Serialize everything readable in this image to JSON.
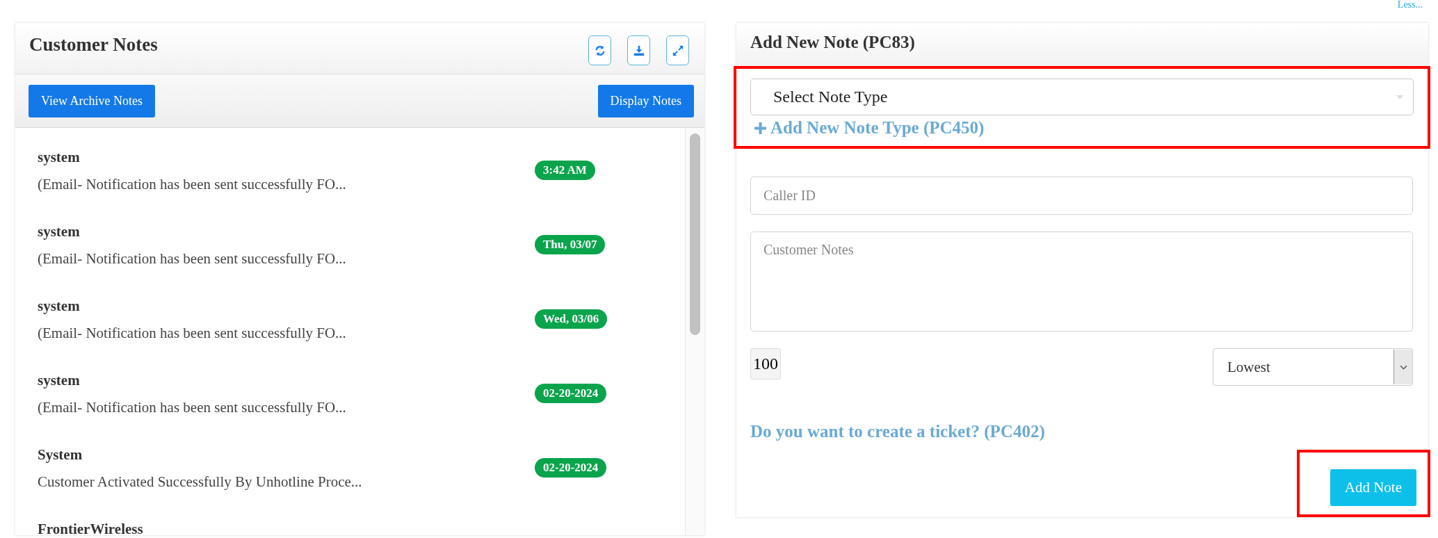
{
  "top_link": "Less...",
  "notes_panel": {
    "title": "Customer Notes",
    "buttons": [
      "View Archive Notes",
      "Display Notes"
    ],
    "notes": [
      {
        "author": "system",
        "text": "(Email- Notification has been sent successfully FO...",
        "time": "3:42 AM"
      },
      {
        "author": "system",
        "text": "(Email- Notification has been sent successfully FO...",
        "time": "Thu, 03/07"
      },
      {
        "author": "system",
        "text": "(Email- Notification has been sent successfully FO...",
        "time": "Wed, 03/06"
      },
      {
        "author": "system",
        "text": "(Email- Notification has been sent successfully FO...",
        "time": "02-20-2024"
      },
      {
        "author": "System",
        "text": "Customer Activated Successfully By Unhotline Proce...",
        "time": "02-20-2024"
      },
      {
        "author": "FrontierWireless"
      }
    ]
  },
  "add_panel": {
    "title": "Add New Note (PC83)",
    "note_type": {
      "placeholder": "Select Note Type",
      "add_link": "Add New Note Type (PC450)",
      "highlighted": true
    },
    "caller_id": {
      "placeholder": "Caller ID"
    },
    "notes_field": {
      "placeholder": "Customer Notes"
    },
    "char_count": "100",
    "priority": {
      "value": "Lowest"
    },
    "ticket_link": "Do you want to create a ticket? (PC402)",
    "submit": {
      "label": "Add Note",
      "highlighted": true
    }
  }
}
